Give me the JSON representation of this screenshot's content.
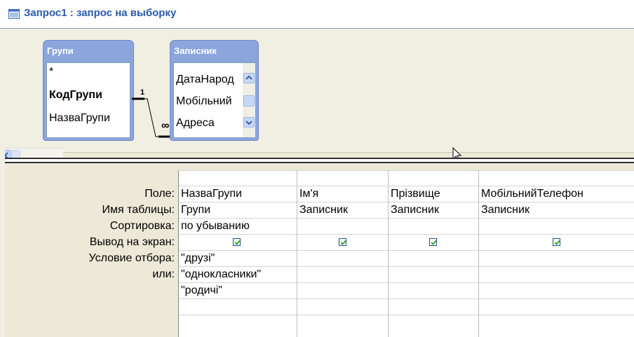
{
  "window": {
    "title": "Запрос1 : запрос на выборку",
    "icon": "query-window-icon"
  },
  "tables": [
    {
      "name": "Групи",
      "fields": [
        "*",
        "КодГрупи",
        "НазваГрупи"
      ],
      "primary_key": "КодГрупи"
    },
    {
      "name": "Записник",
      "fields": [
        "ДатаНарод",
        "Мобільний",
        "Адреса"
      ],
      "has_scrollbar": true
    }
  ],
  "relationship": {
    "one_label": "1",
    "many_label": "∞"
  },
  "grid": {
    "row_labels": [
      "Поле:",
      "Имя таблицы:",
      "Сортировка:",
      "Вывод на экран:",
      "Условие отбора:",
      "или:"
    ],
    "columns": [
      {
        "field": "НазваГрупи",
        "table": "Групи",
        "sort": "по убыванию",
        "show": true,
        "criteria": [
          "\"друзі\"",
          "\"однокласники\"",
          "\"родичі\""
        ]
      },
      {
        "field": "Ім'я",
        "table": "Записник",
        "sort": "",
        "show": true,
        "criteria": []
      },
      {
        "field": "Прізвище",
        "table": "Записник",
        "sort": "",
        "show": true,
        "criteria": []
      },
      {
        "field": "МобільнийТелефон",
        "table": "Записник",
        "sort": "",
        "show": true,
        "criteria": []
      }
    ]
  },
  "colors": {
    "table_header": "#8ca5dd",
    "title_text": "#2b5aa8",
    "checkbox_check": "#21a121"
  }
}
